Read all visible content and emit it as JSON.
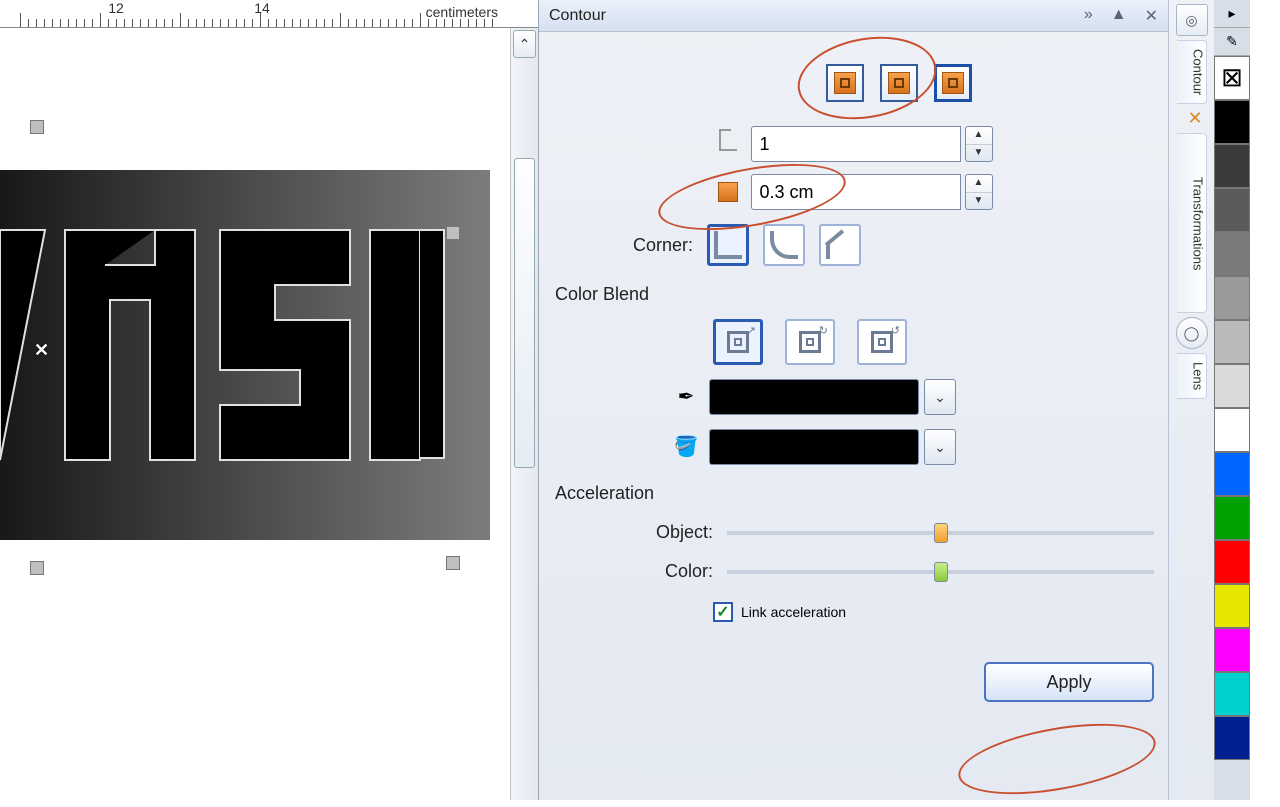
{
  "ruler": {
    "unit": "centimeters",
    "mark1": "12",
    "mark2": "14"
  },
  "panel": {
    "title": "Contour",
    "steps_value": "1",
    "offset_value": "0.3 cm",
    "corner_label": "Corner:",
    "blend_title": "Color Blend",
    "accel_title": "Acceleration",
    "object_label": "Object:",
    "color_label": "Color:",
    "link_label": "Link acceleration",
    "apply_label": "Apply"
  },
  "sidetabs": {
    "contour": "Contour",
    "transformations": "Transformations",
    "lens": "Lens"
  },
  "palette": [
    "#000000",
    "#3a3a3a",
    "#5a5a5a",
    "#7a7a7a",
    "#9a9a9a",
    "#bababa",
    "#dadada",
    "#ffffff",
    "#0066ff",
    "#00a000",
    "#ff0000",
    "#e6e600",
    "#ff00ff",
    "#00d0d0",
    "#002090"
  ],
  "ctrls": {
    "more": "»",
    "up": "▲",
    "close": "✕"
  },
  "spin": {
    "up": "▲",
    "down": "▼"
  }
}
